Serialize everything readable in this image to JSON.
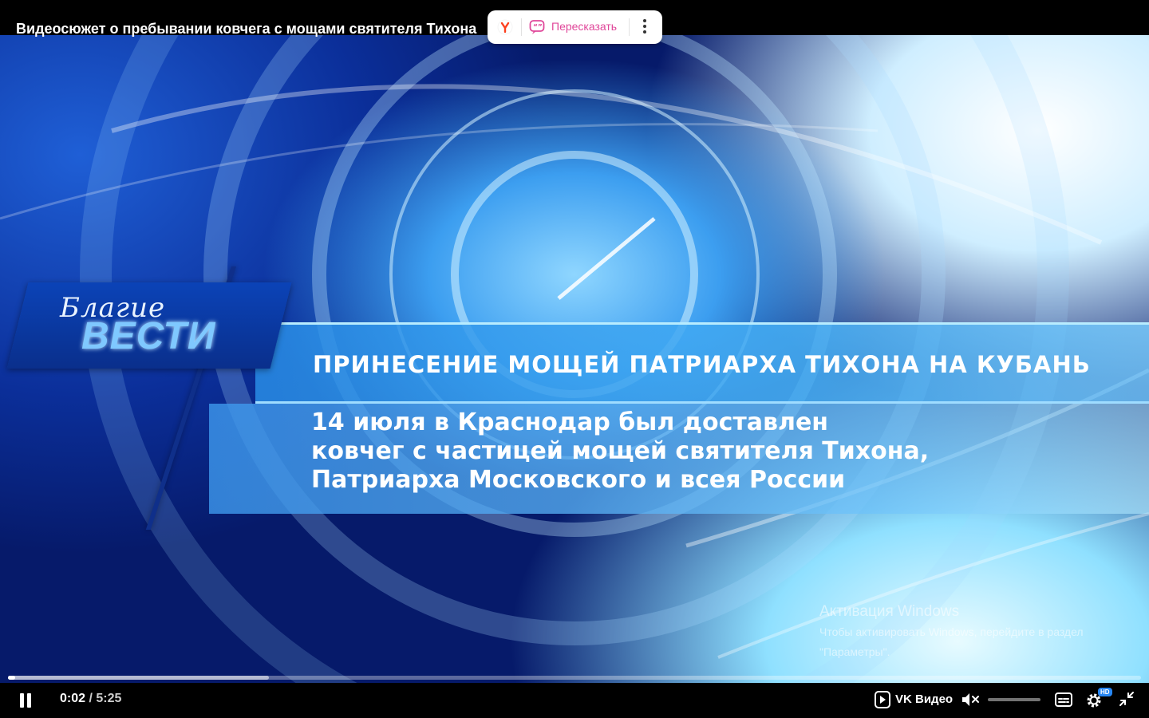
{
  "window": {
    "title": "Видеосюжет о пребывании ковчега с мощами святителя Тихона"
  },
  "retell_popup": {
    "label": "Пересказать",
    "icons": [
      "yandex-icon",
      "retell-icon",
      "more-vert-icon"
    ]
  },
  "video_frame": {
    "logo_script": "Благие",
    "logo_main": "ВЕСТИ",
    "headline": "ПРИНЕСЕНИЕ МОЩЕЙ ПАТРИАРХА ТИХОНА НА КУБАНЬ",
    "body_lines": [
      "14 июля в Краснодар был доставлен",
      "ковчег с частицей мощей святителя Тихона,",
      "Патриарха Московского и всея России"
    ]
  },
  "watermark": {
    "title": "Активация Windows",
    "line1": "Чтобы активировать Windows, перейдите в раздел",
    "line2": "\"Параметры\"."
  },
  "controls": {
    "current_time": "0:02",
    "separator": " / ",
    "duration": "5:25",
    "progress_played": 0.006,
    "progress_buffered": 0.23,
    "brand_label": "VK Видео",
    "volume_muted": true,
    "volume_level": 0.0,
    "quality_badge": "HD"
  },
  "colors": {
    "accent": "#2787f5",
    "retell_text": "#e0479a"
  }
}
